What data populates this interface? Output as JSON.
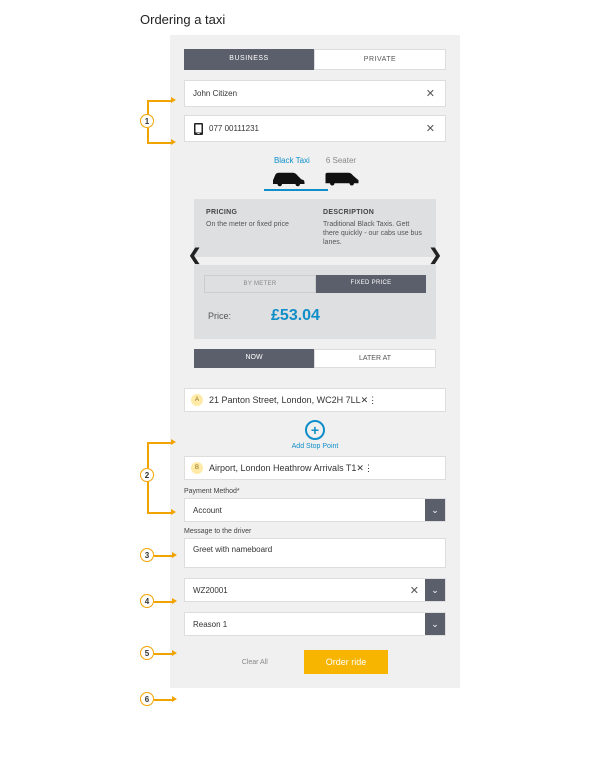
{
  "page_title": "Ordering a taxi",
  "rider_tabs": {
    "business": "BUSINESS",
    "private": "PRIVATE"
  },
  "name_input": "John Citizen",
  "phone_input": "077 00111231",
  "vehicle": {
    "tab1": "Black Taxi",
    "tab2": "6 Seater",
    "pricing_h": "PRICING",
    "pricing_p": "On the meter or fixed price",
    "desc_h": "DESCRIPTION",
    "desc_p": "Traditional Black Taxis. Gett there quickly - our cabs use bus lanes."
  },
  "meter": {
    "by_meter": "BY METER",
    "fixed": "FIXED PRICE",
    "price_lbl": "Price:",
    "price_val": "£53.04"
  },
  "time": {
    "now": "NOW",
    "later": "LATER AT"
  },
  "pickup": "21 Panton Street, London, WC2H 7LL",
  "add_stop": "Add Stop Point",
  "dropoff": "Airport, London Heathrow Arrivals T1",
  "payment_lbl": "Payment Method*",
  "payment_val": "Account",
  "message_lbl": "Message to the driver",
  "message_val": "Greet with nameboard",
  "ref1_val": "WZ20001",
  "ref2_val": "Reason 1",
  "clear_all": "Clear All",
  "order": "Order ride",
  "annotations": {
    "n1": "1",
    "n2": "2",
    "n3": "3",
    "n4": "4",
    "n5": "5",
    "n6": "6"
  }
}
